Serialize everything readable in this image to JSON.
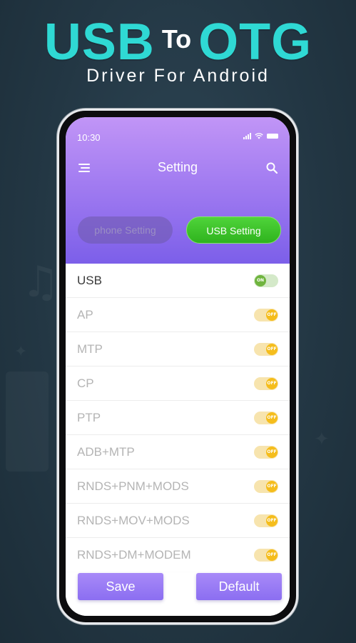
{
  "promo": {
    "title_left": "USB",
    "title_mid": "To",
    "title_right": "OTG",
    "subtitle": "Driver For Android"
  },
  "status_bar": {
    "time": "10:30"
  },
  "header": {
    "title": "Setting"
  },
  "tabs": [
    {
      "label": "phone Setting",
      "active": false
    },
    {
      "label": "USB Setting",
      "active": true
    }
  ],
  "settings": [
    {
      "label": "USB",
      "state": "ON"
    },
    {
      "label": "AP",
      "state": "OFF"
    },
    {
      "label": "MTP",
      "state": "OFF"
    },
    {
      "label": "CP",
      "state": "OFF"
    },
    {
      "label": "PTP",
      "state": "OFF"
    },
    {
      "label": "ADB+MTP",
      "state": "OFF"
    },
    {
      "label": "RNDS+PNM+MODS",
      "state": "OFF"
    },
    {
      "label": "RNDS+MOV+MODS",
      "state": "OFF"
    },
    {
      "label": "RNDS+DM+MODEM",
      "state": "OFF"
    }
  ],
  "buttons": {
    "save": "Save",
    "default": "Default"
  },
  "colors": {
    "accent_teal": "#2fd9d4",
    "header_purple": "#a27cf1",
    "usb_tab_green": "#3cc42a",
    "toggle_off": "#f5bd1c",
    "toggle_on": "#6fb43e",
    "button_purple": "#9a7cf5"
  }
}
